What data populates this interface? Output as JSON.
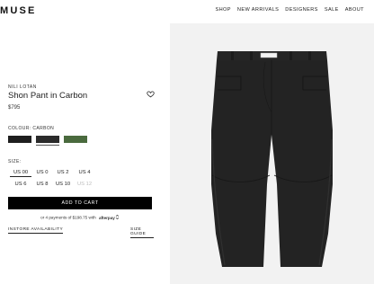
{
  "header": {
    "logo": "MUSE",
    "nav": [
      "SHOP",
      "NEW ARRIVALS",
      "DESIGNERS",
      "SALE",
      "ABOUT"
    ]
  },
  "product": {
    "brand": "NILI LOTAN",
    "title": "Shon Pant in Carbon",
    "price": "$795",
    "heart_icon": "heart-outline-icon"
  },
  "colour": {
    "label": "COLOUR: CARBON",
    "swatches": [
      {
        "name": "black",
        "color": "#1e1e1e",
        "selected": false
      },
      {
        "name": "carbon",
        "color": "#2b2b2b",
        "selected": true
      },
      {
        "name": "green",
        "color": "#4a6a3e",
        "selected": false
      }
    ]
  },
  "size": {
    "label": "SIZE:",
    "options": [
      {
        "label": "US 00",
        "selected": true,
        "available": true
      },
      {
        "label": "US 0",
        "selected": false,
        "available": true
      },
      {
        "label": "US 2",
        "selected": false,
        "available": true
      },
      {
        "label": "US 4",
        "selected": false,
        "available": true
      },
      {
        "label": "US 6",
        "selected": false,
        "available": true
      },
      {
        "label": "US 8",
        "selected": false,
        "available": true
      },
      {
        "label": "US 10",
        "selected": false,
        "available": true
      },
      {
        "label": "US 12",
        "selected": false,
        "available": false
      }
    ]
  },
  "actions": {
    "add_to_cart": "ADD TO CART",
    "installments_text": "or 4 payments of $198.75 with",
    "afterpay": "afterpay",
    "instore": "INSTORE AVAILABILITY",
    "size_guide": "SIZE GUIDE"
  },
  "image": {
    "subject": "black wide-leg pants",
    "background": "#f2f2f2",
    "garment_color": "#232323"
  }
}
